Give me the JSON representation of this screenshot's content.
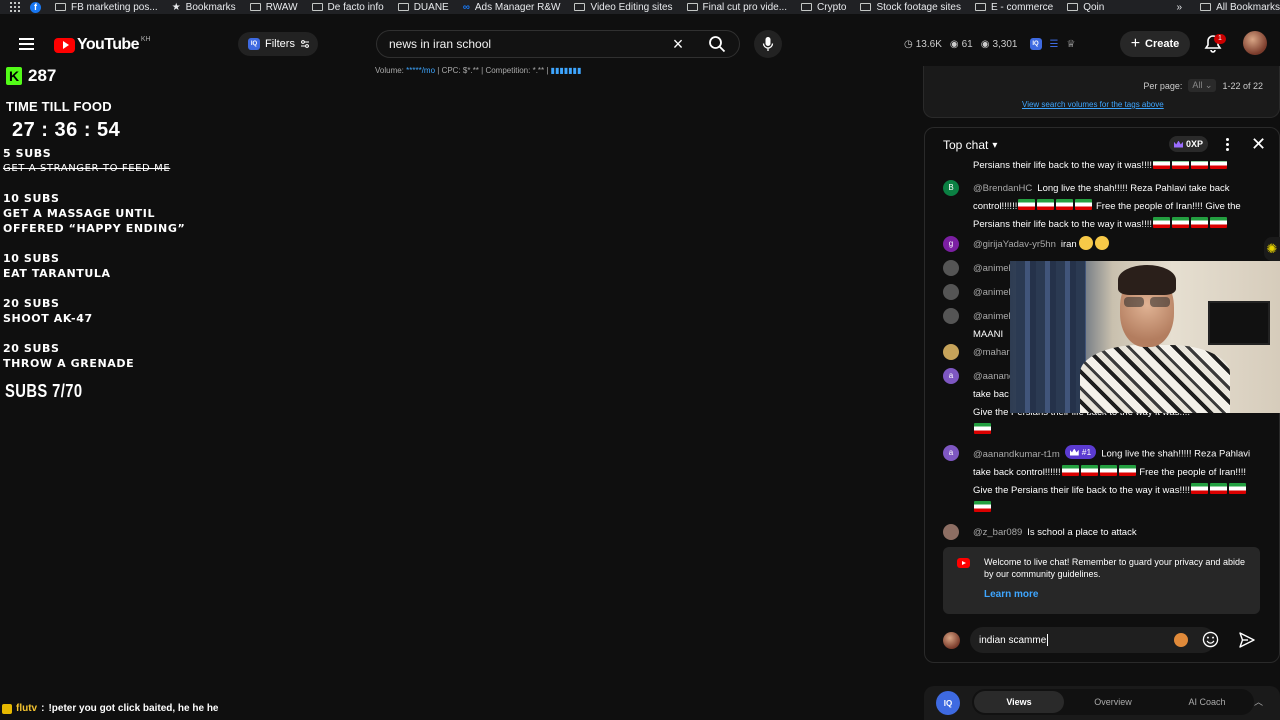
{
  "bookmarks": {
    "items": [
      {
        "label": "",
        "type": "facebook"
      },
      {
        "label": "FB marketing pos...",
        "type": "folder"
      },
      {
        "label": "Bookmarks",
        "type": "star"
      },
      {
        "label": "RWAW",
        "type": "folder"
      },
      {
        "label": "De facto info",
        "type": "folder"
      },
      {
        "label": "DUANE",
        "type": "folder"
      },
      {
        "label": "Ads Manager R&W",
        "type": "meta"
      },
      {
        "label": "Video Editing sites",
        "type": "folder"
      },
      {
        "label": "Final cut pro vide...",
        "type": "folder"
      },
      {
        "label": "Crypto",
        "type": "folder"
      },
      {
        "label": "Stock footage sites",
        "type": "folder"
      },
      {
        "label": "E - commerce",
        "type": "folder"
      },
      {
        "label": "Qoin",
        "type": "folder"
      }
    ],
    "overflow": "»",
    "all_bookmarks": "All Bookmarks"
  },
  "header": {
    "logo_text": "YouTube",
    "country_code": "KH",
    "filters_label": "Filters",
    "search_value": "news in iran school",
    "stats": {
      "views": "13.6K",
      "watching": "61",
      "eye": "3,301"
    },
    "create_label": "Create",
    "notification_count": "1"
  },
  "seo": {
    "volume_label": "Volume: ",
    "volume_value": "*****/mo",
    "cpc": " | CPC: $*.** | Competition: *.** | "
  },
  "overlay": {
    "kick_count": "287",
    "time_till_food_label": "TIME TILL FOOD",
    "timer": "27 : 36 : 54",
    "goals": [
      {
        "subs": "5 SUBS",
        "text": "GET A STRANGER TO FEED ME",
        "done": true
      },
      {
        "subs": "10 SUBS",
        "text": "GET A MASSAGE UNTIL\nOFFERED “HAPPY ENDING”",
        "done": false
      },
      {
        "subs": "10 SUBS",
        "text": "EAT TARANTULA",
        "done": false
      },
      {
        "subs": "20 SUBS",
        "text": "SHOOT AK-47",
        "done": false
      },
      {
        "subs": "20 SUBS",
        "text": "THROW A GRENADE",
        "done": false
      }
    ],
    "subs_progress": "SUBS 7/70",
    "chat_ticker": {
      "user": "flutv",
      "sep": " : ",
      "message": "!peter you got click baited, he he he"
    }
  },
  "tag_panel": {
    "per_page_label": "Per page:",
    "per_page_value": "All",
    "range": "1-22 of 22",
    "view_link": "View search volumes for the tags above"
  },
  "chat": {
    "title": "Top chat",
    "xp": "0XP",
    "messages": [
      {
        "author": "",
        "text": "Persians their life back to the way it was!!!!",
        "flags": 4,
        "avatar": ""
      },
      {
        "author": "@BrendanHC",
        "text": "Long live the shah!!!!! Reza Pahlavi take back control!!!!!!",
        "text2": "Free the people of Iran!!!! Give the Persians their life back to the way it was!!!!",
        "avatar": "B",
        "avatar_color": "#0b8043"
      },
      {
        "author": "@girijaYadav-yr5hn",
        "text": "iran",
        "avatar": "g",
        "avatar_color": "#7b1fa2"
      },
      {
        "author": "@animel",
        "text": "",
        "avatar": "",
        "avatar_color": "#555"
      },
      {
        "author": "@animel",
        "text": "",
        "avatar": "",
        "avatar_color": "#555"
      },
      {
        "author": "@animel",
        "text": "MAANI",
        "avatar": "",
        "avatar_color": "#555"
      },
      {
        "author": "@mahar",
        "text": "",
        "avatar": "",
        "avatar_color": "#c6a35a"
      },
      {
        "author": "@aanand",
        "text": "take bac",
        "text2": "Give the Persians their life back to the way it was!!!!",
        "avatar": "a",
        "avatar_color": "#7e57c2"
      },
      {
        "author": "@aanandkumar-t1m",
        "rank": "#1",
        "text": "Long live the shah!!!!! Reza Pahlavi take back control!!!!!!",
        "text2": "Free the people of Iran!!!! Give the Persians their life back to the way it was!!!!",
        "avatar": "a",
        "avatar_color": "#7e57c2"
      },
      {
        "author": "@z_bar089",
        "text": "Is school a place to attack",
        "avatar": "",
        "avatar_color": "#8d6e63"
      }
    ],
    "notice_text": "Welcome to live chat! Remember to guard your privacy and abide by our community guidelines.",
    "learn_more": "Learn more",
    "input_value": "indian scamme"
  },
  "iq_bar": {
    "logo": "IQ",
    "tabs": [
      "Views",
      "Overview",
      "AI Coach"
    ],
    "active_tab": "Views"
  },
  "colors": {
    "background": "#0f0f0f",
    "youtube_red": "#ff0000",
    "kick_green": "#53fc18",
    "link_blue": "#3ea6ff",
    "vidiq_blue": "#3e6ae1"
  }
}
